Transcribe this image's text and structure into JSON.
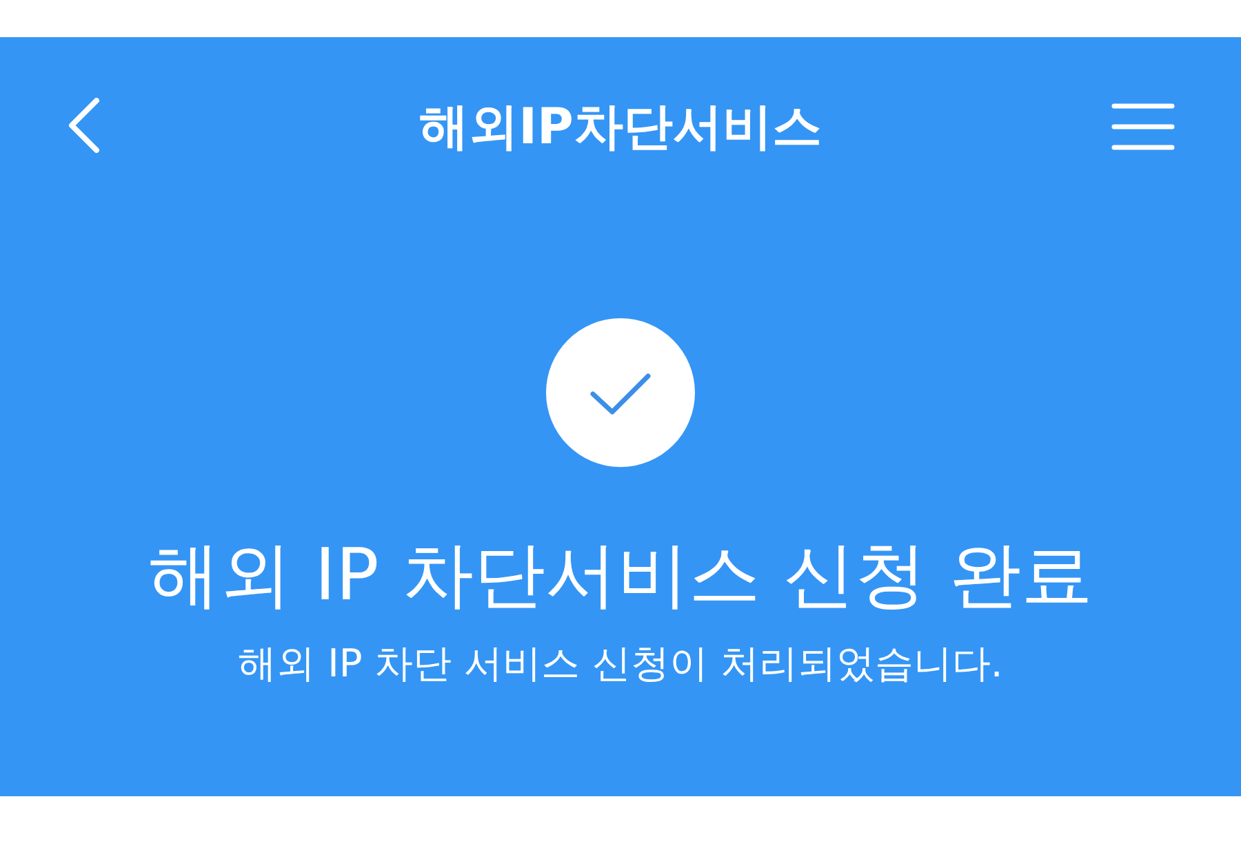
{
  "header": {
    "title": "해외IP차단서비스"
  },
  "result": {
    "heading": "해외 IP 차단서비스 신청 완료",
    "message": "해외 IP 차단 서비스 신청이 처리되었습니다."
  }
}
